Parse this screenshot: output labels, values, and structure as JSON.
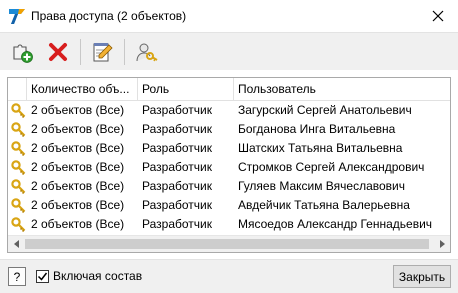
{
  "window": {
    "title": "Права доступа (2 объектов)",
    "close_glyph": "✕",
    "app_icon": "app-logo-icon"
  },
  "toolbar": {
    "buttons": [
      {
        "name": "add-object-button",
        "icon": "puzzle-plus-icon"
      },
      {
        "name": "delete-button",
        "icon": "red-x-icon"
      },
      {
        "name": "edit-button",
        "icon": "notepad-pencil-icon"
      },
      {
        "name": "user-access-button",
        "icon": "user-key-icon"
      }
    ]
  },
  "grid": {
    "columns": [
      "",
      "Количество объ...",
      "Роль",
      "Пользователь"
    ],
    "row_icon": "key-icon",
    "rows": [
      {
        "count": "2 объектов (Все)",
        "role": "Разработчик",
        "user": "Загурский Сергей Анатольевич"
      },
      {
        "count": "2 объектов (Все)",
        "role": "Разработчик",
        "user": "Богданова Инга Витальевна"
      },
      {
        "count": "2 объектов (Все)",
        "role": "Разработчик",
        "user": "Шатских Татьяна Витальевна"
      },
      {
        "count": "2 объектов (Все)",
        "role": "Разработчик",
        "user": "Стромков Сергей Александрович"
      },
      {
        "count": "2 объектов (Все)",
        "role": "Разработчик",
        "user": "Гуляев Максим Вячеславович"
      },
      {
        "count": "2 объектов (Все)",
        "role": "Разработчик",
        "user": "Авдейчик Татьяна Валерьевна"
      },
      {
        "count": "2 объектов (Все)",
        "role": "Разработчик",
        "user": "Мясоедов Александр Геннадьевич"
      }
    ]
  },
  "footer": {
    "help_label": "?",
    "include_checkbox_label": "Включая состав",
    "include_checked": true,
    "close_button_label": "Закрыть"
  },
  "colors": {
    "accent": "#1e88e5",
    "delete_red": "#d81e1e",
    "key_gold": "#d9a514"
  }
}
